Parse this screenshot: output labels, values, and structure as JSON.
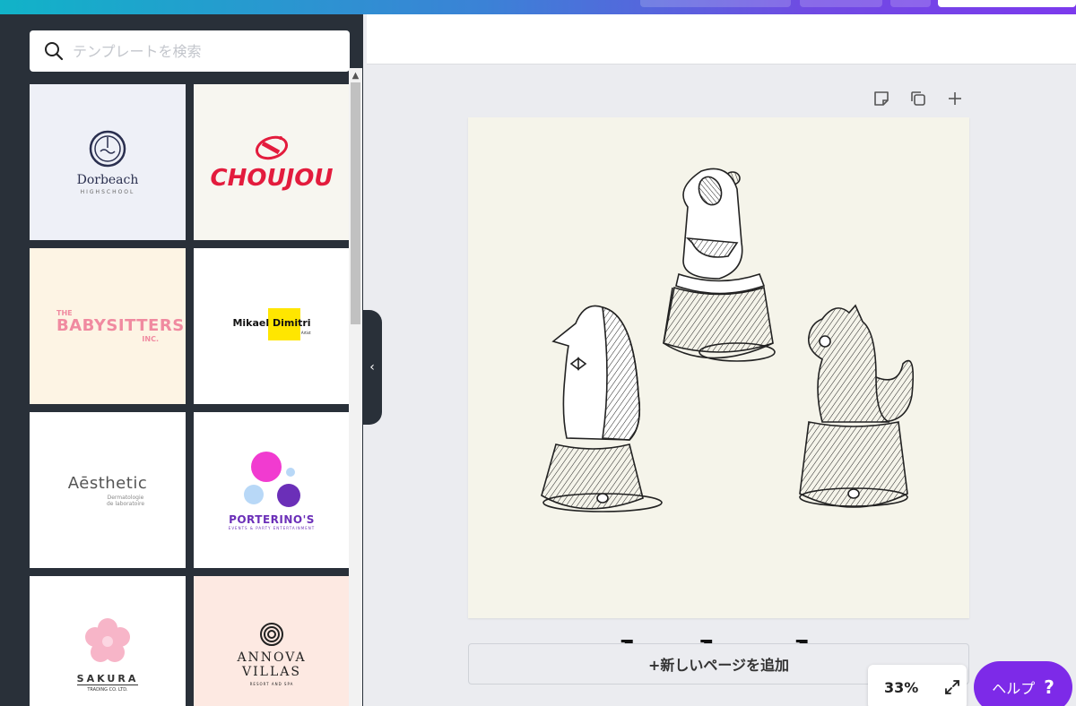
{
  "search": {
    "placeholder": "テンプレートを検索"
  },
  "templates": [
    {
      "title": "Dorbeach",
      "subtitle": "HIGHSCHOOL",
      "bg": "#eef0f7"
    },
    {
      "title": "CHOUJOU",
      "bg": "#f7f6f0"
    },
    {
      "prefix": "THE",
      "title": "BABYSITTERS",
      "suffix": "INC.",
      "bg": "#fdf4e4"
    },
    {
      "title": "Mikael Dimitri",
      "subtitle": "Freelance Artist",
      "bg": "#ffffff"
    },
    {
      "title": "Aēsthetic",
      "subtitle": "Dermatologie",
      "subtitle2": "de laboratoire",
      "bg": "#ffffff"
    },
    {
      "title": "PORTERINO'S",
      "subtitle": "EVENTS & PARTY ENTERTAINMENT",
      "bg": "#ffffff"
    },
    {
      "title": "SAKURA",
      "subtitle": "TRADING CO. LTD.",
      "bg": "#ffffff"
    },
    {
      "title": "ANNOVA",
      "title2": "VILLAS",
      "subtitle": "RESORT AND SPA",
      "bg": "#fde9e2"
    }
  ],
  "canvas": {
    "caption": "on the buckets."
  },
  "add_page_label": "+新しいページを追加",
  "zoom": {
    "value": "33%"
  },
  "help": {
    "label": "ヘルプ",
    "icon_text": "?"
  },
  "colors": {
    "accent": "#7d2ae8",
    "sidebar": "#293039",
    "page": "#f5f4ea",
    "choujou_red": "#e31c3d",
    "porterino_purple": "#6b2fb8"
  }
}
